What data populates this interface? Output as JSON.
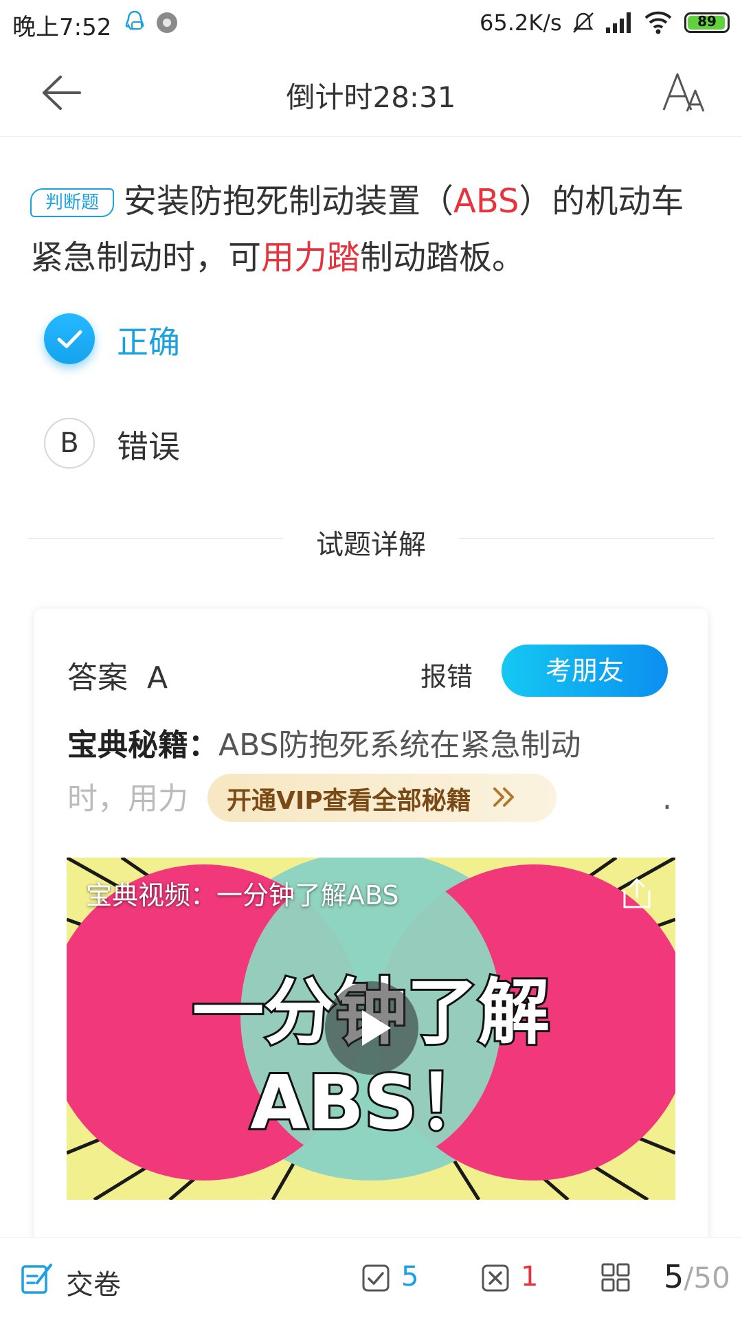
{
  "status_bar": {
    "time": "晚上7:52",
    "net_speed": "65.2K/s",
    "battery": "89"
  },
  "header": {
    "countdown": "倒计时28:31"
  },
  "question": {
    "type_badge": "判断题",
    "text_1": "安装防抱死制动装置（",
    "highlight_1": "ABS",
    "text_2": "）的机动车紧急制动时，可",
    "highlight_2": "用力踏",
    "text_3": "制动踏板。"
  },
  "options": [
    {
      "letter": "A",
      "label": "正确",
      "selected": true
    },
    {
      "letter": "B",
      "label": "错误",
      "selected": false
    }
  ],
  "section_title": "试题详解",
  "explanation": {
    "answer_label": "答案",
    "answer_value": "A",
    "report_label": "报错",
    "friend_button": "考朋友",
    "tip_title": "宝典秘籍：",
    "tip_text": "ABS防抱死系统在紧急制动",
    "tip_text_2": "时，用力",
    "tip_trailing": ".",
    "vip_button": "开通VIP查看全部秘籍",
    "video": {
      "title": "宝典视频：一分钟了解ABS",
      "headline_1": "一分钟了解",
      "headline_2": "ABS！"
    }
  },
  "bottom_bar": {
    "submit_label": "交卷",
    "correct_count": "5",
    "wrong_count": "1",
    "current": "5",
    "total": "/50"
  },
  "colors": {
    "accent": "#1aa1e0",
    "highlight_red": "#e8323c",
    "vip_gold": "#7a4a16"
  }
}
